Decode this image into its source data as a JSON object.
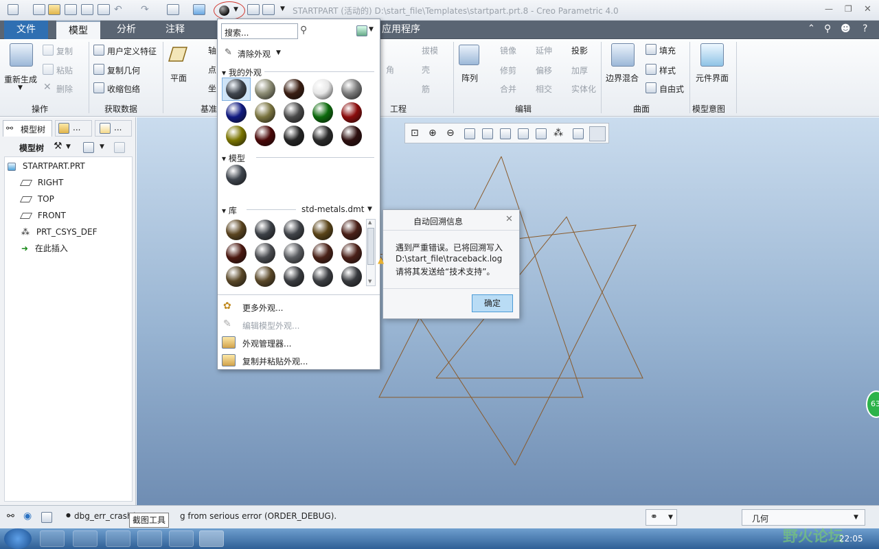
{
  "app": {
    "title": "STARTPART (活动的) D:\\start_file\\Templates\\startpart.prt.8 - Creo Parametric 4.0"
  },
  "tabs": [
    {
      "label": "文件"
    },
    {
      "label": "模型"
    },
    {
      "label": "分析"
    },
    {
      "label": "注释"
    },
    {
      "label": "应用程序"
    }
  ],
  "ribbon": {
    "regen_label": "重新生成",
    "ops": {
      "copy": "复制",
      "paste": "粘贴",
      "delete": "删除",
      "group": "操作"
    },
    "getdata": {
      "udf": "用户定义特征",
      "copygeom": "复制几何",
      "shrinkwrap": "收缩包络",
      "group": "获取数据"
    },
    "datum": {
      "plane": "平面",
      "axis": "轴",
      "point": "点",
      "csys": "坐",
      "group": "基准"
    },
    "eng": {
      "draft": "拔模",
      "corner": "角",
      "shell": "壳",
      "rib": "筋",
      "group": "工程"
    },
    "edit": {
      "pattern": "阵列",
      "mirror": "镜像",
      "extend": "延伸",
      "project": "投影",
      "trim": "修剪",
      "offset": "偏移",
      "thicken": "加厚",
      "merge": "合并",
      "intersect": "相交",
      "solidify": "实体化",
      "group": "编辑"
    },
    "surface": {
      "boundary": "边界混合",
      "fill": "填充",
      "style": "样式",
      "freestyle": "自由式",
      "group": "曲面"
    },
    "intent": {
      "component": "元件界面",
      "group": "模型意图"
    }
  },
  "leftpanel": {
    "tab1": "模型树",
    "tab2": "...",
    "tab3": "...",
    "toolbar_label": "模型树",
    "tree": [
      {
        "label": "STARTPART.PRT"
      },
      {
        "label": "RIGHT"
      },
      {
        "label": "TOP"
      },
      {
        "label": "FRONT"
      },
      {
        "label": "PRT_CSYS_DEF"
      },
      {
        "label": "在此插入"
      }
    ]
  },
  "appearance_menu": {
    "search_placeholder": "搜索...",
    "clear": "清除外观",
    "my_section": "我的外观",
    "model_section": "模型",
    "library_section": "库",
    "library_file": "std-metals.dmt",
    "my_colors": [
      "#3f454d",
      "#8a8a72",
      "#3a1e12",
      "#e6e6e6",
      "#7a7a7a",
      "#101a80",
      "#7a7440",
      "#4a4a4a",
      "#0c6a0c",
      "#8a0c0c",
      "#7a7400",
      "#4a0808",
      "#252525",
      "#2a2a2a",
      "#2e1010"
    ],
    "model_colors": [
      "#3f454d"
    ],
    "lib_colors": [
      "#5a4420",
      "#3c4046",
      "#404348",
      "#5a4418",
      "#4a2018",
      "#4a1810",
      "#4a4c50",
      "#5a5c60",
      "#4a2218",
      "#4a2018",
      "#5a4828",
      "#5a4828",
      "#3a3c40",
      "#3c3e42",
      "#383a3e"
    ],
    "more": "更多外观...",
    "edit_model": "编辑模型外观...",
    "manager": "外观管理器...",
    "copypaste": "复制并粘贴外观..."
  },
  "dialog": {
    "title": "自动回溯信息",
    "line1": "遇到严重错误。已将回溯写入",
    "line2": "D:\\start_file\\traceback.log",
    "line3": "请将其发送给“技术支持”。",
    "ok": "确定"
  },
  "statusbar": {
    "message_prefix": "dbg_err_crash(",
    "message_suffix": "g from serious error (ORDER_DEBUG).",
    "tooltip": "截图工具",
    "filter": "几何"
  },
  "taskbar": {
    "clock": "22:05",
    "watermark": "野火论坛"
  },
  "side_badge": "63",
  "colors": {
    "tabbar": "#5a6573",
    "accent": "#8ea3bb",
    "sketch_line": "#8a5a2a"
  }
}
